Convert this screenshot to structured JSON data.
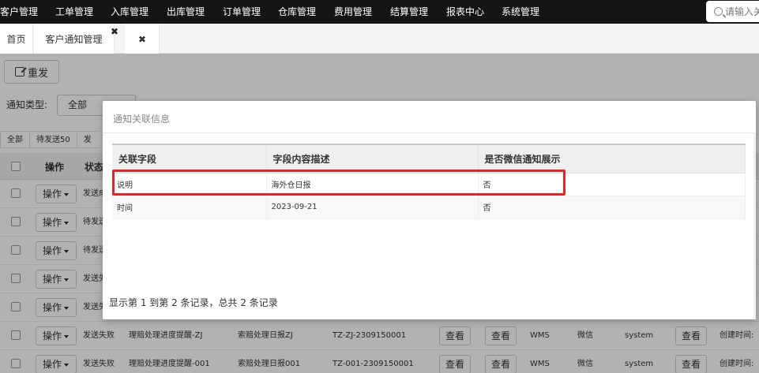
{
  "topnav": {
    "items": [
      "客户管理",
      "工单管理",
      "入库管理",
      "出库管理",
      "订单管理",
      "仓库管理",
      "费用管理",
      "结算管理",
      "报表中心",
      "系统管理"
    ],
    "search_placeholder": "请输入关"
  },
  "tabs": [
    {
      "label": "首页"
    },
    {
      "label": "客户通知管理",
      "close": "✖"
    },
    {
      "label": "",
      "close": "✖"
    }
  ],
  "toolbar": {
    "resend_label": "重发"
  },
  "filter": {
    "type_label": "通知类型:",
    "type_value": "全部"
  },
  "status_tabs": [
    "全部",
    "待发送50",
    "发"
  ],
  "grid": {
    "headers": [
      "操作",
      "状态"
    ],
    "op_label": "操作",
    "rows": [
      {
        "status": "发送成"
      },
      {
        "status": "待发送"
      },
      {
        "status": "待发送"
      },
      {
        "status": "发送失"
      },
      {
        "status": "发送失"
      },
      {
        "status": "发送失败",
        "name": "理赔处理进度提醒-ZJ",
        "desc": "索赔处理日报ZJ",
        "code": "TZ-ZJ-2309150001",
        "view1": "查看",
        "view2": "查看",
        "source": "WMS",
        "channel": "微信",
        "user": "system",
        "view3": "查看",
        "created": "创建时间:"
      },
      {
        "status": "发送失败",
        "name": "理赔处理进度提醒-001",
        "desc": "索赔处理日报001",
        "code": "TZ-001-2309150001",
        "view1": "查看",
        "view2": "查看",
        "source": "WMS",
        "channel": "微信",
        "user": "system",
        "view3": "查看",
        "created": "创建时间:"
      }
    ]
  },
  "modal": {
    "title": "通知关联信息",
    "columns": [
      "关联字段",
      "字段内容描述",
      "是否微信通知展示"
    ],
    "rows": [
      {
        "field": "说明",
        "content": "海外仓日报",
        "wechat": "否"
      },
      {
        "field": "时间",
        "content": "2023-09-21",
        "wechat": "否"
      }
    ],
    "footer": "显示第 1 到第 2 条记录，总共 2 条记录"
  },
  "colors": {
    "nav_bg": "#151515",
    "highlight": "#e0262c"
  }
}
